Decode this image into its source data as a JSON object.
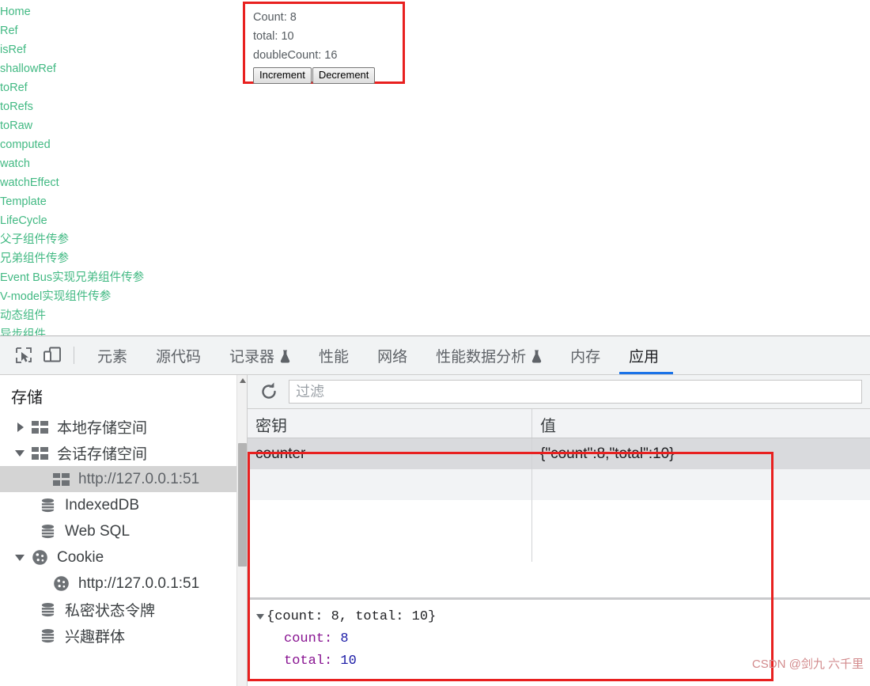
{
  "page": {
    "nav_links": [
      "Home",
      "Ref",
      "isRef",
      "shallowRef",
      "toRef",
      "toRefs",
      "toRaw",
      "computed",
      "watch",
      "watchEffect",
      "Template",
      "LifeCycle",
      "父子组件传参",
      "兄弟组件传参",
      "Event Bus实现兄弟组件传参",
      "V-model实现组件传参",
      "动态组件",
      "异步组件"
    ],
    "link_color": "#42b983",
    "counter": {
      "count_line": "Count: 8",
      "total_line": "total: 10",
      "double_line": "doubleCount: 16",
      "increment_label": "Increment",
      "decrement_label": "Decrement"
    }
  },
  "devtools": {
    "toolbar": {
      "inspect_icon": "inspect-element-icon",
      "device_icon": "device-toolbar-icon",
      "tabs": [
        {
          "label": "元素",
          "active": false,
          "flask": false
        },
        {
          "label": "源代码",
          "active": false,
          "flask": false
        },
        {
          "label": "记录器",
          "active": false,
          "flask": true
        },
        {
          "label": "性能",
          "active": false,
          "flask": false
        },
        {
          "label": "网络",
          "active": false,
          "flask": false
        },
        {
          "label": "性能数据分析",
          "active": false,
          "flask": true
        },
        {
          "label": "内存",
          "active": false,
          "flask": false
        },
        {
          "label": "应用",
          "active": true,
          "flask": false
        }
      ],
      "active_tab_color": "#1a73e8"
    },
    "sidebar": {
      "title": "存储",
      "items": [
        {
          "label": "本地存储空间",
          "icon": "table-icon",
          "twisty": "right",
          "level": 1,
          "selected": false
        },
        {
          "label": "会话存储空间",
          "icon": "table-icon",
          "twisty": "down",
          "level": 1,
          "selected": false
        },
        {
          "label": "http://127.0.0.1:51",
          "icon": "table-icon",
          "twisty": "none",
          "level": 2,
          "selected": true
        },
        {
          "label": "IndexedDB",
          "icon": "database-icon",
          "twisty": "none",
          "level": 1,
          "selected": false
        },
        {
          "label": "Web SQL",
          "icon": "database-icon",
          "twisty": "none",
          "level": 1,
          "selected": false
        },
        {
          "label": "Cookie",
          "icon": "cookie-icon",
          "twisty": "down",
          "level": 1,
          "selected": false
        },
        {
          "label": "http://127.0.0.1:51",
          "icon": "cookie-icon",
          "twisty": "none",
          "level": 2,
          "selected": false
        },
        {
          "label": "私密状态令牌",
          "icon": "database-icon",
          "twisty": "none",
          "level": 1,
          "selected": false
        },
        {
          "label": "兴趣群体",
          "icon": "database-icon",
          "twisty": "none",
          "level": 1,
          "selected": false
        }
      ]
    },
    "filter_bar": {
      "refresh_icon": "refresh-icon",
      "filter_placeholder": "过滤",
      "filter_value": ""
    },
    "table": {
      "headers": {
        "key": "密钥",
        "value": "值"
      },
      "rows": [
        {
          "key": "counter",
          "value": "{\"count\":8,\"total\":10}",
          "selected": true
        }
      ]
    },
    "preview": {
      "header": "{count: 8, total: 10}",
      "entries": [
        {
          "key": "count:",
          "value": "8"
        },
        {
          "key": "total:",
          "value": "10"
        }
      ],
      "key_color": "#881391",
      "value_color": "#1a1aa6"
    },
    "annotation_color": "#e8201f"
  },
  "watermark": "CSDN @剑九 六千里"
}
